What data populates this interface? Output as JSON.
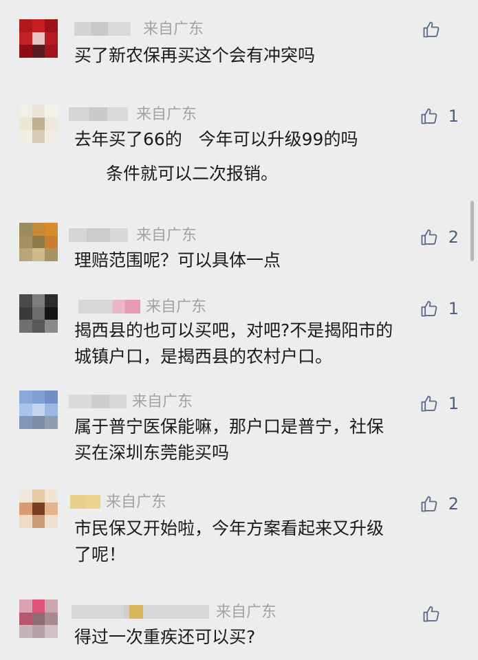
{
  "comments": [
    {
      "location": "来自广东",
      "likes": "",
      "lines": [
        "买了新农保再买这个会有冲突吗"
      ],
      "sub": ""
    },
    {
      "location": "来自广东",
      "likes": "1",
      "lines": [
        "去年买了66的   今年可以升级99的吗"
      ],
      "sub": "条件就可以二次报销。"
    },
    {
      "location": "来自广东",
      "likes": "2",
      "lines": [
        "理赔范围呢？可以具体一点"
      ],
      "sub": ""
    },
    {
      "location": "来自广东",
      "likes": "1",
      "lines": [
        "揭西县的也可以买吧，对吧?不是揭阳市的",
        "城镇户口，是揭西县的农村户口。"
      ],
      "sub": ""
    },
    {
      "location": "来自广东",
      "likes": "1",
      "lines": [
        "属于普宁医保能嘛，那户口是普宁，社保",
        "买在深圳东莞能买吗"
      ],
      "sub": ""
    },
    {
      "location": "来自广东",
      "likes": "2",
      "lines": [
        "市民保又开始啦，今年方案看起来又升级",
        "了呢！"
      ],
      "sub": ""
    },
    {
      "location": "来自广东",
      "likes": "",
      "lines": [
        "得过一次重疾还可以买?"
      ],
      "sub": ""
    }
  ],
  "icons": {
    "like": "thumbs-up-icon"
  },
  "colors": {
    "background": "#ededed",
    "location": "#a3a3a3",
    "like": "#5b6b8c"
  }
}
